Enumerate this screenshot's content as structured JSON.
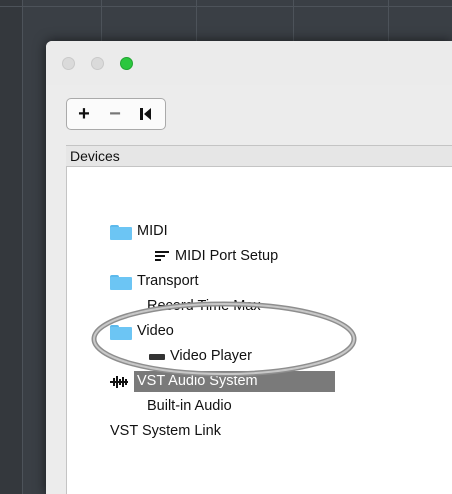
{
  "window": {
    "traffic_lights": {
      "close": "#dadada",
      "minimize": "#dadada",
      "zoom": "#2bc73e"
    }
  },
  "toolbar": {
    "add_label": "+",
    "remove_label": "−",
    "reset_icon": "reset-to-start-icon"
  },
  "section": {
    "title": "Devices"
  },
  "tree": {
    "items": [
      {
        "label": "MIDI",
        "icon": "folder-icon",
        "level": 0
      },
      {
        "label": "MIDI Port Setup",
        "icon": "midi-port-icon",
        "level": 1
      },
      {
        "label": "Transport",
        "icon": "folder-icon",
        "level": 0
      },
      {
        "label": "Record Time Max",
        "icon": "",
        "level": 1
      },
      {
        "label": "Video",
        "icon": "folder-icon",
        "level": 0
      },
      {
        "label": "Video Player",
        "icon": "video-icon",
        "level": 1
      },
      {
        "label": "VST Audio System",
        "icon": "waveform-icon",
        "level": 0,
        "selected": true
      },
      {
        "label": "Built-in Audio",
        "icon": "",
        "level": 1
      },
      {
        "label": "VST System Link",
        "icon": "",
        "level": 0
      }
    ]
  },
  "colors": {
    "folder": "#6cc5f4",
    "selection": "#7a7a7a",
    "background": "#3a3f45"
  }
}
